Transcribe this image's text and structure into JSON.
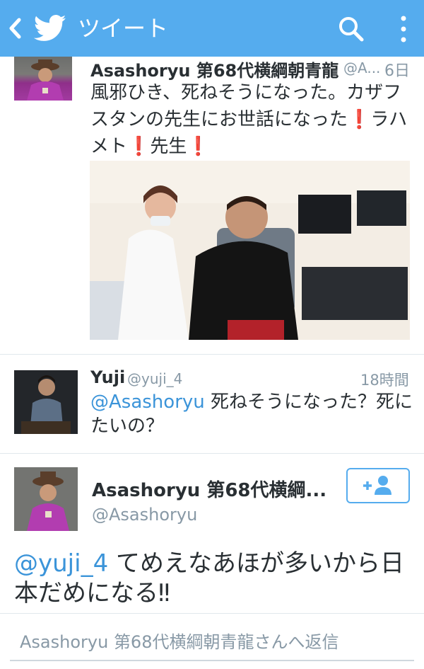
{
  "header": {
    "title": "ツイート",
    "back_icon": "chevron-left-icon",
    "logo_icon": "twitter-bird-icon",
    "search_icon": "search-icon",
    "more_icon": "more-vertical-icon",
    "bg_color": "#55acee"
  },
  "tweet1": {
    "name": "Asashoryu 第68代横綱朝青龍",
    "handle": "@A...",
    "time": "6日",
    "text_parts": [
      "風邪ひき、死ねそうになった。カザフスタンの先生にお世話になった",
      "❗",
      "ラハメト",
      "❗",
      "先生",
      "❗"
    ],
    "photo": "photo-doctor-and-man"
  },
  "tweet2": {
    "name": "Yuji",
    "handle": "@yuji_4",
    "time": "18時間",
    "mention": "@Asashoryu",
    "text": " 死ねそうになった？死にたいの？"
  },
  "tweet3": {
    "name": "Asashoryu 第68代横綱...",
    "handle": "@Asashoryu",
    "follow_icon": "add-user-icon",
    "mention": "@yuji_4",
    "text": " てめえなあほが多いから日本だめになる‼"
  },
  "reply": {
    "placeholder": "Asashoryu 第68代横綱朝青龍さんへ返信"
  },
  "colors": {
    "accent": "#55acee",
    "link": "#3b94d9",
    "muted": "#8899a6",
    "text": "#292f33",
    "exclaim": "#d9232e"
  }
}
